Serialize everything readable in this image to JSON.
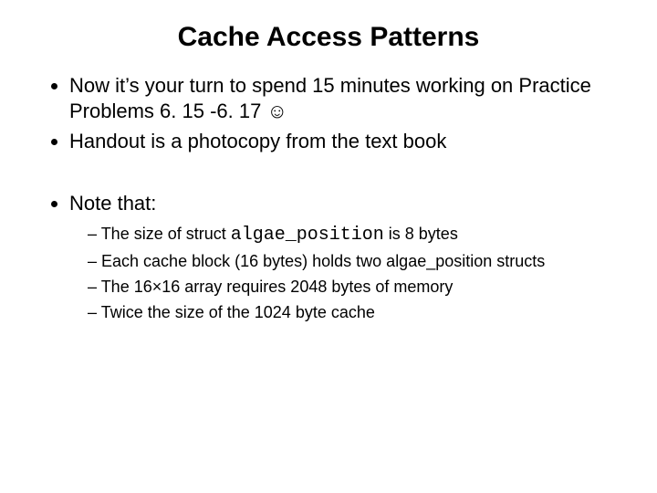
{
  "title": "Cache Access Patterns",
  "bullets": {
    "b1": "Now it’s your turn to spend 15 minutes working on Practice Problems 6. 15 -6. 17 ☺",
    "b2": "Handout is a photocopy from the text book",
    "b3": "Note that:"
  },
  "sub": {
    "s1a": "The size of struct ",
    "s1code": "algae_position",
    "s1b": " is 8 bytes",
    "s2": "Each cache block (16 bytes) holds two algae_position structs",
    "s3": "The 16×16 array requires 2048 bytes of memory",
    "s4": "Twice the size of the 1024 byte cache"
  }
}
